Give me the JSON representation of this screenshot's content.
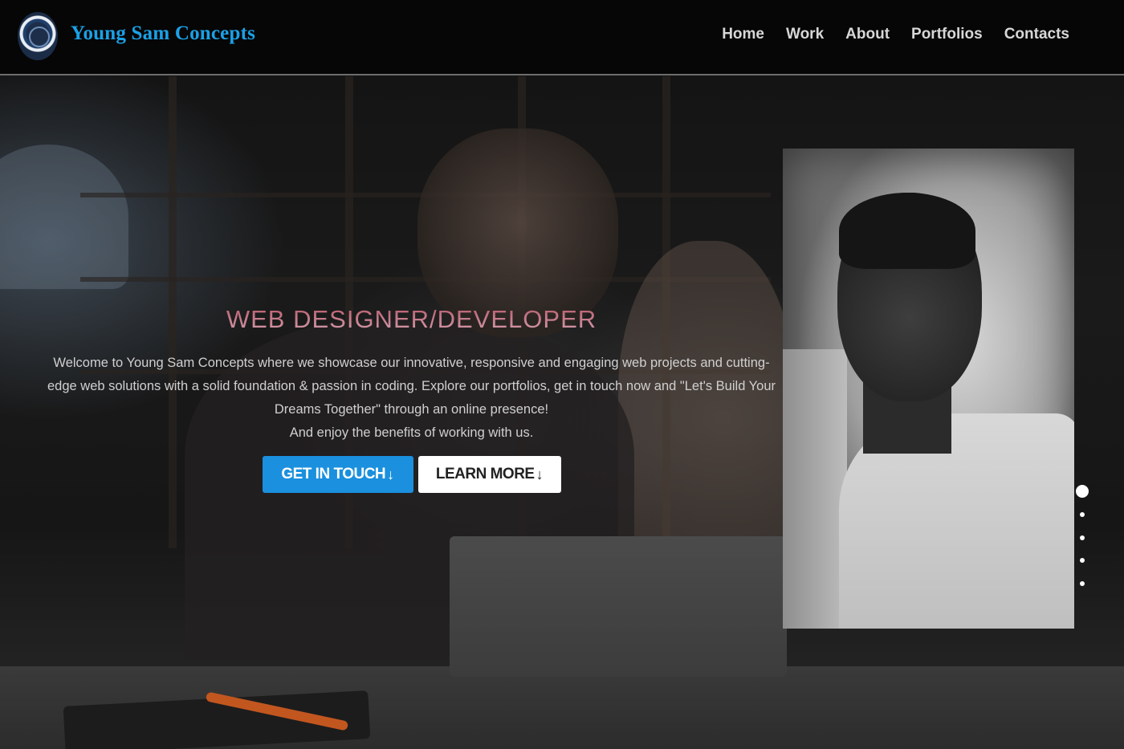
{
  "header": {
    "brand": "Young Sam Concepts",
    "logo": "logo-emblem",
    "nav": [
      "Home",
      "Work",
      "About",
      "Portfolios",
      "Contacts"
    ]
  },
  "hero": {
    "title": "WEB DESIGNER/DEVELOPER",
    "description": "Welcome to Young Sam Concepts where we showcase our innovative, responsive and engaging web projects and cutting-edge web solutions with a solid foundation & passion in coding. Explore our portfolios, get in touch now and \"Let's Build Your Dreams Together\" through an online presence!",
    "description2": "And enjoy the benefits of working with us.",
    "primary_button": "GET IN TOUCH",
    "secondary_button": "LEARN MORE"
  },
  "carousel": {
    "slides": 5,
    "active": 1
  },
  "colors": {
    "brand": "#1ba1e6",
    "primary_button": "#1a90de",
    "title": "#c07a8e"
  }
}
